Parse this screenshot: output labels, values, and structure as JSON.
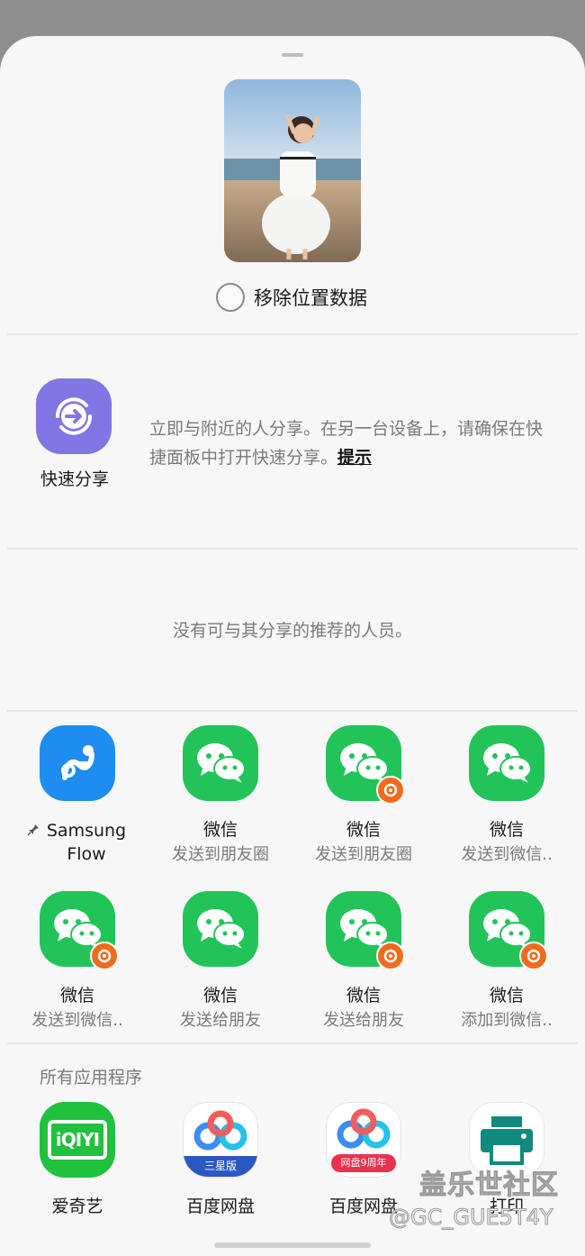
{
  "sheet": {
    "remove_location_label": "移除位置数据"
  },
  "quick_share": {
    "label": "快速分享",
    "description": "立即与附近的人分享。在另一台设备上，请确保在快捷面板中打开快速分享。",
    "hint_link": "提示"
  },
  "recommend": {
    "empty_text": "没有可与其分享的推荐的人员。"
  },
  "direct_share": [
    {
      "name": "Samsung Flow",
      "sub": "",
      "icon": "samsung-flow-icon",
      "pinned": true
    },
    {
      "name": "微信",
      "sub": "发送到朋友圈",
      "icon": "wechat-icon",
      "badge": false
    },
    {
      "name": "微信",
      "sub": "发送到朋友圈",
      "icon": "wechat-icon",
      "badge": true
    },
    {
      "name": "微信",
      "sub": "发送到微信..",
      "icon": "wechat-icon",
      "badge": false
    },
    {
      "name": "微信",
      "sub": "发送到微信..",
      "icon": "wechat-icon",
      "badge": true
    },
    {
      "name": "微信",
      "sub": "发送给朋友",
      "icon": "wechat-icon",
      "badge": false
    },
    {
      "name": "微信",
      "sub": "发送给朋友",
      "icon": "wechat-icon",
      "badge": true
    },
    {
      "name": "微信",
      "sub": "添加到微信..",
      "icon": "wechat-icon",
      "badge": true
    }
  ],
  "all_apps": {
    "label": "所有应用程序",
    "items": [
      {
        "name": "爱奇艺",
        "icon": "iqiyi-icon",
        "logo_text": "iQIYI"
      },
      {
        "name": "百度网盘",
        "icon": "baidu-netdisk-icon",
        "tag": "三星版"
      },
      {
        "name": "百度网盘",
        "icon": "baidu-netdisk-icon",
        "tag": "网盘9周年"
      },
      {
        "name": "打印",
        "icon": "print-icon"
      }
    ]
  },
  "watermark": {
    "line1": "盖乐世社区",
    "line2": "@GC_GUE5T4Y"
  },
  "colors": {
    "wechat_green": "#22c45a",
    "quick_share_purple": "#8176e4",
    "badge_orange": "#f26a1b",
    "samsung_flow_blue": "#1e8cf0",
    "iqiyi_green": "#1fc13d"
  }
}
